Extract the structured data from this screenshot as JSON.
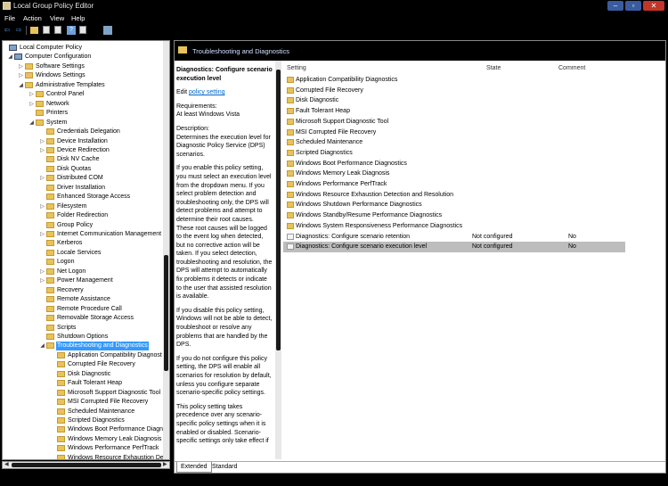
{
  "window": {
    "title": "Local Group Policy Editor",
    "min": "–",
    "max": "▫",
    "close": "✕"
  },
  "menu": [
    "File",
    "Action",
    "View",
    "Help"
  ],
  "toolbar": {
    "back": "⇦",
    "forward": "⇨",
    "help": "?"
  },
  "tree": {
    "items": [
      {
        "label": "Local Computer Policy",
        "level": 0,
        "exp": "",
        "icon": "computer"
      },
      {
        "label": "Computer Configuration",
        "level": 1,
        "exp": "◢",
        "icon": "computer"
      },
      {
        "label": "Software Settings",
        "level": 2,
        "exp": "▷",
        "icon": "folder"
      },
      {
        "label": "Windows Settings",
        "level": 2,
        "exp": "▷",
        "icon": "folder"
      },
      {
        "label": "Administrative Templates",
        "level": 2,
        "exp": "◢",
        "icon": "folder"
      },
      {
        "label": "Control Panel",
        "level": 3,
        "exp": "▷",
        "icon": "folder"
      },
      {
        "label": "Network",
        "level": 3,
        "exp": "▷",
        "icon": "folder"
      },
      {
        "label": "Printers",
        "level": 3,
        "exp": "",
        "icon": "folder"
      },
      {
        "label": "System",
        "level": 3,
        "exp": "◢",
        "icon": "folder"
      },
      {
        "label": "Credentials Delegation",
        "level": 4,
        "exp": "",
        "icon": "folder"
      },
      {
        "label": "Device Installation",
        "level": 4,
        "exp": "▷",
        "icon": "folder"
      },
      {
        "label": "Device Redirection",
        "level": 4,
        "exp": "▷",
        "icon": "folder"
      },
      {
        "label": "Disk NV Cache",
        "level": 4,
        "exp": "",
        "icon": "folder"
      },
      {
        "label": "Disk Quotas",
        "level": 4,
        "exp": "",
        "icon": "folder"
      },
      {
        "label": "Distributed COM",
        "level": 4,
        "exp": "▷",
        "icon": "folder"
      },
      {
        "label": "Driver Installation",
        "level": 4,
        "exp": "",
        "icon": "folder"
      },
      {
        "label": "Enhanced Storage Access",
        "level": 4,
        "exp": "",
        "icon": "folder"
      },
      {
        "label": "Filesystem",
        "level": 4,
        "exp": "▷",
        "icon": "folder"
      },
      {
        "label": "Folder Redirection",
        "level": 4,
        "exp": "",
        "icon": "folder"
      },
      {
        "label": "Group Policy",
        "level": 4,
        "exp": "",
        "icon": "folder"
      },
      {
        "label": "Internet Communication Management",
        "level": 4,
        "exp": "▷",
        "icon": "folder"
      },
      {
        "label": "Kerberos",
        "level": 4,
        "exp": "",
        "icon": "folder"
      },
      {
        "label": "Locale Services",
        "level": 4,
        "exp": "",
        "icon": "folder"
      },
      {
        "label": "Logon",
        "level": 4,
        "exp": "",
        "icon": "folder"
      },
      {
        "label": "Net Logon",
        "level": 4,
        "exp": "▷",
        "icon": "folder"
      },
      {
        "label": "Power Management",
        "level": 4,
        "exp": "▷",
        "icon": "folder"
      },
      {
        "label": "Recovery",
        "level": 4,
        "exp": "",
        "icon": "folder"
      },
      {
        "label": "Remote Assistance",
        "level": 4,
        "exp": "",
        "icon": "folder"
      },
      {
        "label": "Remote Procedure Call",
        "level": 4,
        "exp": "",
        "icon": "folder"
      },
      {
        "label": "Removable Storage Access",
        "level": 4,
        "exp": "",
        "icon": "folder"
      },
      {
        "label": "Scripts",
        "level": 4,
        "exp": "",
        "icon": "folder"
      },
      {
        "label": "Shutdown Options",
        "level": 4,
        "exp": "",
        "icon": "folder"
      },
      {
        "label": "Troubleshooting and Diagnostics",
        "level": 4,
        "exp": "◢",
        "icon": "folder",
        "selected": true
      },
      {
        "label": "Application Compatibility Diagnost",
        "level": 5,
        "exp": "",
        "icon": "folder"
      },
      {
        "label": "Corrupted File Recovery",
        "level": 5,
        "exp": "",
        "icon": "folder"
      },
      {
        "label": "Disk Diagnostic",
        "level": 5,
        "exp": "",
        "icon": "folder"
      },
      {
        "label": "Fault Tolerant Heap",
        "level": 5,
        "exp": "",
        "icon": "folder"
      },
      {
        "label": "Microsoft Support Diagnostic Tool",
        "level": 5,
        "exp": "",
        "icon": "folder"
      },
      {
        "label": "MSI Corrupted File Recovery",
        "level": 5,
        "exp": "",
        "icon": "folder"
      },
      {
        "label": "Scheduled Maintenance",
        "level": 5,
        "exp": "",
        "icon": "folder"
      },
      {
        "label": "Scripted Diagnostics",
        "level": 5,
        "exp": "",
        "icon": "folder"
      },
      {
        "label": "Windows Boot Performance Diagno",
        "level": 5,
        "exp": "",
        "icon": "folder"
      },
      {
        "label": "Windows Memory Leak Diagnosis",
        "level": 5,
        "exp": "",
        "icon": "folder"
      },
      {
        "label": "Windows Performance PerfTrack",
        "level": 5,
        "exp": "",
        "icon": "folder"
      },
      {
        "label": "Windows Resource Exhaustion Det",
        "level": 5,
        "exp": "",
        "icon": "folder"
      }
    ]
  },
  "pane": {
    "header": "Troubleshooting and Diagnostics",
    "description": {
      "title": "Diagnostics: Configure scenario execution level",
      "edit_prefix": "Edit",
      "edit_link": "policy setting",
      "requirements_label": "Requirements:",
      "requirements": "At least Windows Vista",
      "description_label": "Description:",
      "p1": "Determines the execution level for Diagnostic Policy Service (DPS) scenarios.",
      "p2": "If you enable this policy setting, you must select an execution level from the dropdown menu.  If you select problem detection and troubleshooting only, the DPS will detect problems and attempt to determine their root causes.  These root causes will be logged to the event log when detected, but no corrective action will be taken.  If you select detection, troubleshooting and resolution, the DPS will attempt to automatically fix problems it detects or indicate to the user that assisted resolution is available.",
      "p3": "If you disable this policy setting, Windows will not be able to detect, troubleshoot or resolve any problems that are handled by the DPS.",
      "p4": "If you do not configure this policy setting, the DPS will enable all scenarios for resolution by default, unless you configure separate scenario-specific policy settings.",
      "p5": "This policy setting takes precedence over any scenario-specific policy settings when it is enabled or disabled.  Scenario-specific settings only take effect if"
    },
    "columns": {
      "setting": "Setting",
      "state": "State",
      "comment": "Comment"
    },
    "rows": [
      {
        "setting": "Application Compatibility Diagnostics",
        "state": "",
        "comment": "",
        "icon": "folder"
      },
      {
        "setting": "Corrupted File Recovery",
        "state": "",
        "comment": "",
        "icon": "folder"
      },
      {
        "setting": "Disk Diagnostic",
        "state": "",
        "comment": "",
        "icon": "folder"
      },
      {
        "setting": "Fault Tolerant Heap",
        "state": "",
        "comment": "",
        "icon": "folder"
      },
      {
        "setting": "Microsoft Support Diagnostic Tool",
        "state": "",
        "comment": "",
        "icon": "folder"
      },
      {
        "setting": "MSI Corrupted File Recovery",
        "state": "",
        "comment": "",
        "icon": "folder"
      },
      {
        "setting": "Scheduled Maintenance",
        "state": "",
        "comment": "",
        "icon": "folder"
      },
      {
        "setting": "Scripted Diagnostics",
        "state": "",
        "comment": "",
        "icon": "folder"
      },
      {
        "setting": "Windows Boot Performance Diagnostics",
        "state": "",
        "comment": "",
        "icon": "folder"
      },
      {
        "setting": "Windows Memory Leak Diagnosis",
        "state": "",
        "comment": "",
        "icon": "folder"
      },
      {
        "setting": "Windows Performance PerfTrack",
        "state": "",
        "comment": "",
        "icon": "folder"
      },
      {
        "setting": "Windows Resource Exhaustion Detection and Resolution",
        "state": "",
        "comment": "",
        "icon": "folder"
      },
      {
        "setting": "Windows Shutdown Performance Diagnostics",
        "state": "",
        "comment": "",
        "icon": "folder"
      },
      {
        "setting": "Windows Standby/Resume Performance Diagnostics",
        "state": "",
        "comment": "",
        "icon": "folder"
      },
      {
        "setting": "Windows System Responsiveness Performance Diagnostics",
        "state": "",
        "comment": "",
        "icon": "folder"
      },
      {
        "setting": "Diagnostics: Configure scenario retention",
        "state": "Not configured",
        "comment": "No",
        "icon": "doc"
      },
      {
        "setting": "Diagnostics: Configure scenario execution level",
        "state": "Not configured",
        "comment": "No",
        "icon": "doc",
        "selected": true
      }
    ],
    "tabs": [
      "Extended",
      "Standard"
    ]
  }
}
